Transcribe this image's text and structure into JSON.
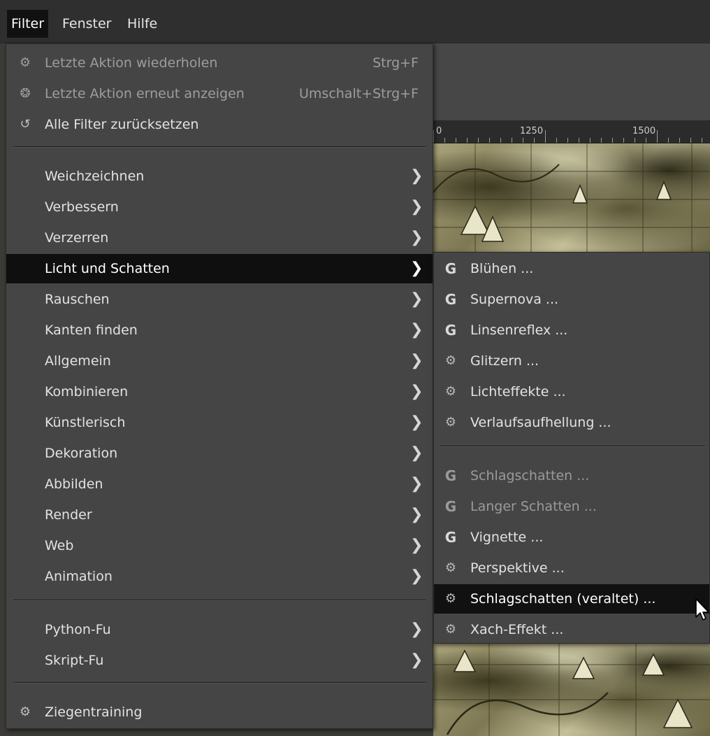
{
  "menubar": {
    "items": [
      {
        "label": "Filter",
        "active": true
      },
      {
        "label": "Fenster",
        "active": false
      },
      {
        "label": "Hilfe",
        "active": false
      }
    ]
  },
  "ruler": {
    "labels": [
      "1250",
      "1500"
    ]
  },
  "filter_menu": {
    "top_items": [
      {
        "label": "Letzte Aktion wiederholen",
        "shortcut": "Strg+F",
        "icon": "plugin-icon",
        "glyph": "⚙",
        "disabled": true
      },
      {
        "label": "Letzte Aktion erneut anzeigen",
        "shortcut": "Umschalt+Strg+F",
        "icon": "reshow-icon",
        "glyph": "❂",
        "disabled": true
      },
      {
        "label": "Alle Filter zurücksetzen",
        "shortcut": "",
        "icon": "reset-icon",
        "glyph": "↺",
        "disabled": false
      }
    ],
    "categories": [
      {
        "label": "Weichzeichnen",
        "arrow": "❯"
      },
      {
        "label": "Verbessern",
        "arrow": "❯"
      },
      {
        "label": "Verzerren",
        "arrow": "❯"
      },
      {
        "label": "Licht und Schatten",
        "arrow": "❯",
        "highlight": true
      },
      {
        "label": "Rauschen",
        "arrow": "❯"
      },
      {
        "label": "Kanten finden",
        "arrow": "❯"
      },
      {
        "label": "Allgemein",
        "arrow": "❯"
      },
      {
        "label": "Kombinieren",
        "arrow": "❯"
      },
      {
        "label": "Künstlerisch",
        "arrow": "❯"
      },
      {
        "label": "Dekoration",
        "arrow": "❯"
      },
      {
        "label": "Abbilden",
        "arrow": "❯"
      },
      {
        "label": "Render",
        "arrow": "❯"
      },
      {
        "label": "Web",
        "arrow": "❯"
      },
      {
        "label": "Animation",
        "arrow": "❯"
      }
    ],
    "scripts": [
      {
        "label": "Python-Fu",
        "arrow": "❯"
      },
      {
        "label": "Skript-Fu",
        "arrow": "❯"
      }
    ],
    "bottom": {
      "label": "Ziegentraining",
      "icon": "plugin-icon",
      "glyph": "⚙"
    }
  },
  "submenu": {
    "group1": [
      {
        "label": "Blühen ...",
        "icon": "gegl-icon",
        "glyph": "G"
      },
      {
        "label": "Supernova ...",
        "icon": "gegl-icon",
        "glyph": "G"
      },
      {
        "label": "Linsenreflex ...",
        "icon": "gegl-icon",
        "glyph": "G"
      },
      {
        "label": "Glitzern ...",
        "icon": "plugin-icon",
        "glyph": "⚙"
      },
      {
        "label": "Lichteffekte ...",
        "icon": "plugin-icon",
        "glyph": "⚙"
      },
      {
        "label": "Verlaufsaufhellung ...",
        "icon": "plugin-icon",
        "glyph": "⚙"
      }
    ],
    "group2": [
      {
        "label": "Schlagschatten ...",
        "icon": "gegl-icon",
        "glyph": "G",
        "disabled": true
      },
      {
        "label": "Langer Schatten ...",
        "icon": "gegl-icon",
        "glyph": "G",
        "disabled": true
      },
      {
        "label": "Vignette ...",
        "icon": "gegl-icon",
        "glyph": "G"
      },
      {
        "label": "Perspektive ...",
        "icon": "plugin-icon",
        "glyph": "⚙"
      },
      {
        "label": "Schlagschatten (veraltet) ...",
        "icon": "plugin-icon",
        "glyph": "⚙",
        "highlight": true
      },
      {
        "label": "Xach-Effekt ...",
        "icon": "plugin-icon",
        "glyph": "⚙"
      }
    ]
  }
}
